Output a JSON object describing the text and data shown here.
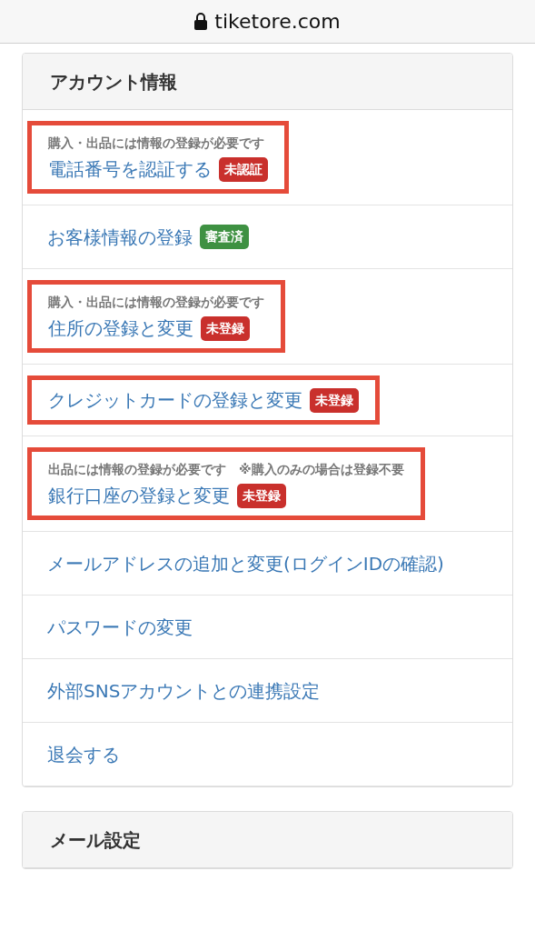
{
  "address_bar": {
    "url": "tiketore.com"
  },
  "sections": [
    {
      "title": "アカウント情報",
      "items": [
        {
          "note": "購入・出品には情報の登録が必要です",
          "label": "電話番号を認証する",
          "badge": {
            "text": "未認証",
            "color": "#c9302c"
          },
          "highlighted": true
        },
        {
          "label": "お客様情報の登録",
          "badge": {
            "text": "審査済",
            "color": "#3e9142"
          },
          "highlighted": false
        },
        {
          "note": "購入・出品には情報の登録が必要です",
          "label": "住所の登録と変更",
          "badge": {
            "text": "未登録",
            "color": "#c9302c"
          },
          "highlighted": true
        },
        {
          "label": "クレジットカードの登録と変更",
          "badge": {
            "text": "未登録",
            "color": "#c9302c"
          },
          "highlighted": true
        },
        {
          "note": "出品には情報の登録が必要です　※購入のみの場合は登録不要",
          "label": "銀行口座の登録と変更",
          "badge": {
            "text": "未登録",
            "color": "#c9302c"
          },
          "highlighted": true
        },
        {
          "label": "メールアドレスの追加と変更(ログインIDの確認)",
          "highlighted": false
        },
        {
          "label": "パスワードの変更",
          "highlighted": false
        },
        {
          "label": "外部SNSアカウントとの連携設定",
          "highlighted": false
        },
        {
          "label": "退会する",
          "highlighted": false
        }
      ]
    },
    {
      "title": "メール設定"
    }
  ]
}
